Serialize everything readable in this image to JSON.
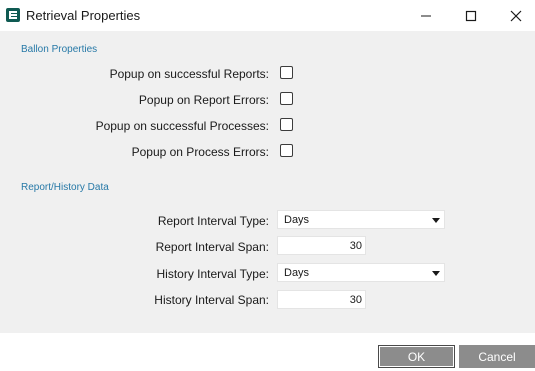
{
  "window": {
    "title": "Retrieval Properties",
    "icons": {
      "app": "app-logo-icon",
      "minimize": "minimize-icon",
      "maximize": "maximize-icon",
      "close": "close-icon"
    }
  },
  "balloon": {
    "heading": "Ballon Properties",
    "options": [
      {
        "label": "Popup on successful Reports:",
        "checked": false
      },
      {
        "label": "Popup on Report Errors:",
        "checked": false
      },
      {
        "label": "Popup on successful Processes:",
        "checked": false
      },
      {
        "label": "Popup on Process Errors:",
        "checked": false
      }
    ]
  },
  "history": {
    "heading": "Report/History Data",
    "report_type_label": "Report Interval Type:",
    "report_type_value": "Days",
    "report_span_label": "Report Interval Span:",
    "report_span_value": "30",
    "history_type_label": "History Interval Type:",
    "history_type_value": "Days",
    "history_span_label": "History Interval Span:",
    "history_span_value": "30"
  },
  "footer": {
    "ok_label": "OK",
    "cancel_label": "Cancel"
  },
  "colors": {
    "section_heading": "#2779a7",
    "content_bg": "#f0f0f0",
    "button_bg": "#8c8c8c",
    "app_icon": "#0f5a52"
  }
}
